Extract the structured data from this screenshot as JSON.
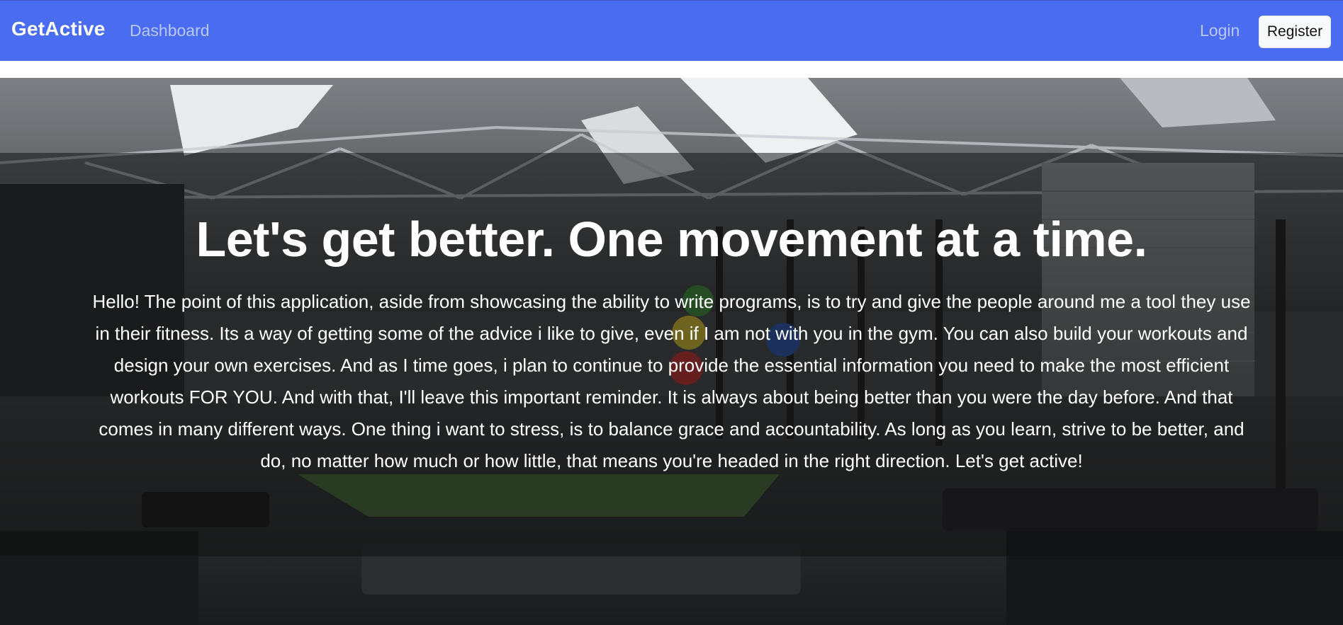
{
  "navbar": {
    "brand": "GetActive",
    "dashboard_label": "Dashboard",
    "login_label": "Login",
    "register_label": "Register",
    "background_color": "#4a6cf0"
  },
  "hero": {
    "title": "Let's get better. One movement at a time.",
    "body": "Hello! The point of this application, aside from showcasing the ability to write programs, is to try and give the people around me a tool they use in their fitness. Its a way of getting some of the advice i like to give, even if I am not with you in the gym. You can also build your workouts and design your own exercises. And as I time goes, i plan to continue to provide the essential information you need to make the most efficient workouts FOR YOU. And with that, I'll leave this important reminder. It is always about being better than you were the day before. And that comes in many different ways. One thing i want to stress, is to balance grace and accountability. As long as you learn, strive to be better, and do, no matter how much or how little, that means you're headed in the right direction. Let's get active!"
  }
}
